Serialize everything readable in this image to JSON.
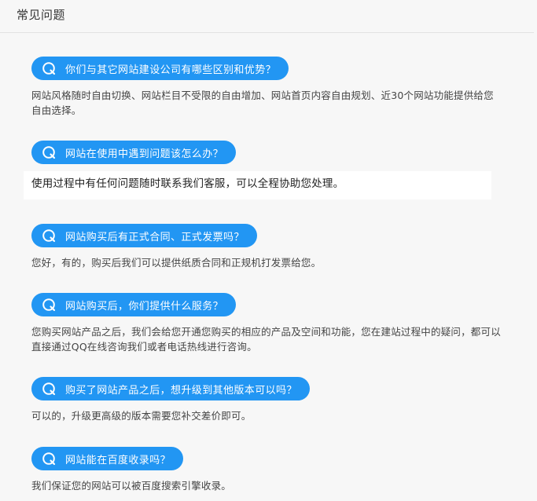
{
  "page": {
    "title": "常见问题"
  },
  "faq": [
    {
      "question": "你们与其它网站建设公司有哪些区别和优势？",
      "answer": "网站风格随时自由切换、网站栏目不受限的自由增加、网站首页内容自由规划、近30个网站功能提供给您自由选择。"
    },
    {
      "question": "网站在使用中遇到问题该怎么办？",
      "answer": "使用过程中有任何问题随时联系我们客服，可以全程协助您处理。"
    },
    {
      "question": "网站购买后有正式合同、正式发票吗？",
      "answer": "您好，有的，购买后我们可以提供纸质合同和正规机打发票给您。"
    },
    {
      "question": "网站购买后，你们提供什么服务？",
      "answer": "您购买网站产品之后，我们会给您开通您购买的相应的产品及空间和功能，您在建站过程中的疑问，都可以直接通过QQ在线咨询我们或者电话热线进行咨询。"
    },
    {
      "question": "购买了网站产品之后，想升级到其他版本可以吗？",
      "answer": "可以的，升级更高级的版本需要您补交差价即可。"
    },
    {
      "question": "网站能在百度收录吗？",
      "answer": "我们保证您的网站可以被百度搜索引擎收录。"
    }
  ],
  "colors": {
    "accent": "#2296f3",
    "background": "#f7f7f7"
  },
  "icons": {
    "question": "q-question-icon"
  }
}
